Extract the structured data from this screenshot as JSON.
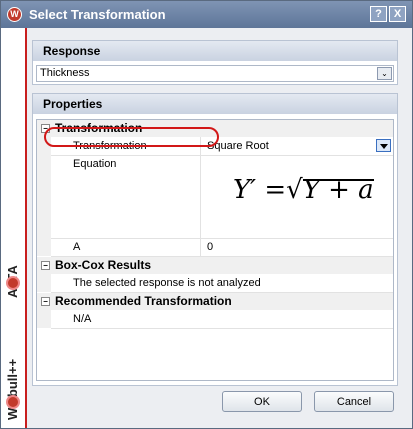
{
  "title": "Select Transformation",
  "title_buttons": {
    "help": "?",
    "close": "X"
  },
  "side_brand": {
    "alta": "ALTA",
    "weibull": "Weibull++"
  },
  "response": {
    "header": "Response",
    "value": "Thickness"
  },
  "properties": {
    "header": "Properties",
    "transformation_section": "Transformation",
    "transformation_label": "Transformation",
    "transformation_value": "Square Root",
    "equation_label": "Equation",
    "equation": {
      "lhs": "Y′ =",
      "radicand": "Y + a"
    },
    "a_label": "A",
    "a_value": "0",
    "boxcox_section": "Box-Cox Results",
    "boxcox_text": "The selected response is not analyzed",
    "recommended_section": "Recommended Transformation",
    "recommended_value": "N/A"
  },
  "buttons": {
    "ok": "OK",
    "cancel": "Cancel"
  },
  "colors": {
    "titlebar": "#6f86aa",
    "brand_red": "#c81e1e",
    "highlight": "#d21818"
  }
}
